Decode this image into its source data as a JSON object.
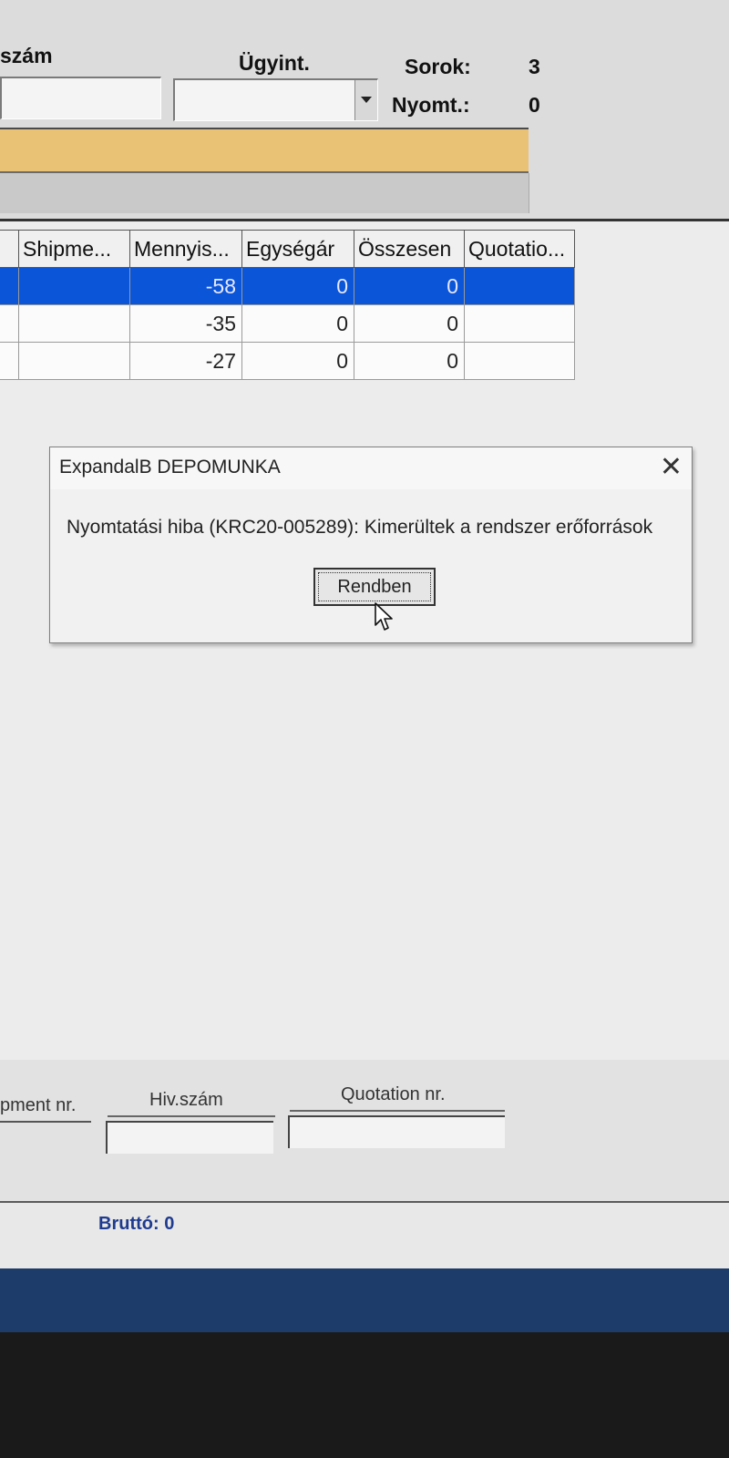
{
  "header": {
    "col_szam": "szám",
    "col_ugyint": "Ügyint.",
    "sorok_label": "Sorok:",
    "sorok_value": "3",
    "nyomt_label": "Nyomt.:",
    "nyomt_value": "0"
  },
  "grid": {
    "columns": [
      "Shipme...",
      "Mennyis...",
      "Egységár",
      "Összesen",
      "Quotatio..."
    ],
    "rows": [
      [
        "",
        "-58",
        "0",
        "0",
        ""
      ],
      [
        "",
        "-35",
        "0",
        "0",
        ""
      ],
      [
        "",
        "-27",
        "0",
        "0",
        ""
      ]
    ],
    "selected_row": 0
  },
  "dialog": {
    "title": "ExpandalB DEPOMUNKA",
    "close_glyph": "✕",
    "message": "Nyomtatási hiba (KRC20-005289): Kimerültek a rendszer erőforrások",
    "ok_label": "Rendben"
  },
  "bottom": {
    "shipment_label": "pment nr.",
    "hivszam_label": "Hiv.szám",
    "quotation_label": "Quotation nr."
  },
  "status": {
    "brutto": "Bruttó: 0"
  }
}
